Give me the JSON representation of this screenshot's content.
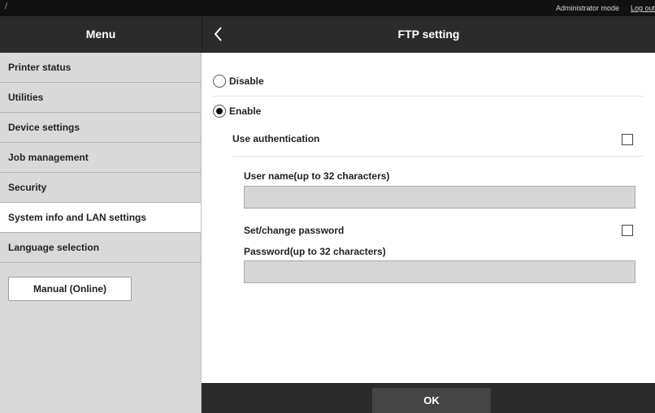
{
  "topbar": {
    "left_glyph": "/",
    "mode_label": "Administrator mode",
    "logout_label": "Log out"
  },
  "header": {
    "menu_title": "Menu",
    "page_title": "FTP setting"
  },
  "sidebar": {
    "items": [
      {
        "label": "Printer status",
        "active": false
      },
      {
        "label": "Utilities",
        "active": false
      },
      {
        "label": "Device settings",
        "active": false
      },
      {
        "label": "Job management",
        "active": false
      },
      {
        "label": "Security",
        "active": false
      },
      {
        "label": "System info and LAN settings",
        "active": true
      },
      {
        "label": "Language selection",
        "active": false
      }
    ],
    "manual_button": "Manual (Online)"
  },
  "main": {
    "options": [
      {
        "label": "Disable",
        "selected": false
      },
      {
        "label": "Enable",
        "selected": true
      }
    ],
    "use_auth_label": "Use authentication",
    "use_auth_checked": false,
    "username_label": "User name(up to 32 characters)",
    "username_value": "",
    "set_password_label": "Set/change password",
    "set_password_checked": false,
    "password_label": "Password(up to 32 characters)",
    "password_value": ""
  },
  "footer": {
    "ok_label": "OK"
  },
  "colors": {
    "header_bg": "#2b2b2b",
    "topbar_bg": "#111111",
    "sidebar_bg": "#d9d9d9",
    "field_bg": "#d6d6d6"
  }
}
